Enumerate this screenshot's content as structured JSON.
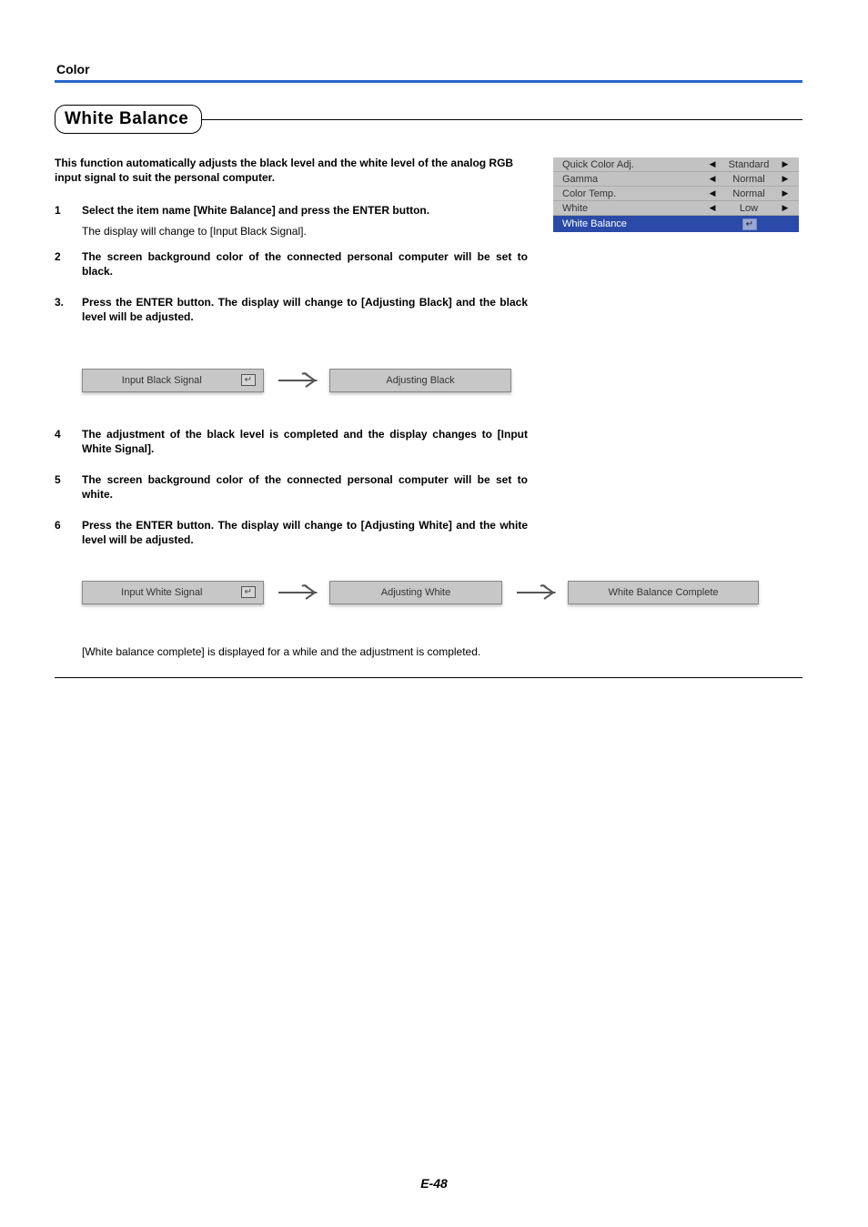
{
  "section_label": "Color",
  "heading": "White Balance",
  "intro": "This function automatically adjusts the black level and the white level of the analog RGB input signal to suit the personal computer.",
  "steps_a": [
    {
      "num": "1",
      "title": "Select the item name [White Balance] and press the ENTER button.",
      "note": "The display will change to [Input Black Signal]."
    },
    {
      "num": "2",
      "title": "The screen background color of the connected personal computer will be set to black."
    },
    {
      "num": "3.",
      "title": "Press the ENTER button. The display will change to [Adjusting Black] and the black level will be adjusted."
    }
  ],
  "flow1": {
    "box1": "Input Black Signal",
    "box2": "Adjusting Black"
  },
  "steps_b": [
    {
      "num": "4",
      "title": "The adjustment of the black level is completed and the display changes to [Input White Signal]."
    },
    {
      "num": "5",
      "title": "The screen background color of the connected personal computer will be set to white."
    },
    {
      "num": "6",
      "title": "Press the ENTER button. The display will change to [Adjusting White] and the white level will be adjusted."
    }
  ],
  "flow2": {
    "box1": "Input White Signal",
    "box2": "Adjusting White",
    "box3": "White Balance Complete"
  },
  "final_note": "[White balance complete] is displayed for a while and the adjustment is completed.",
  "wb_menu": {
    "rows": [
      {
        "name": "Quick Color Adj.",
        "value": "Standard"
      },
      {
        "name": "Gamma",
        "value": "Normal"
      },
      {
        "name": "Color Temp.",
        "value": "Normal"
      },
      {
        "name": "White",
        "value": "Low"
      }
    ],
    "selected": {
      "name": "White Balance"
    }
  },
  "enter_glyph": "↵",
  "left_tri": "◀",
  "right_tri": "▶",
  "page_num": "E-48"
}
